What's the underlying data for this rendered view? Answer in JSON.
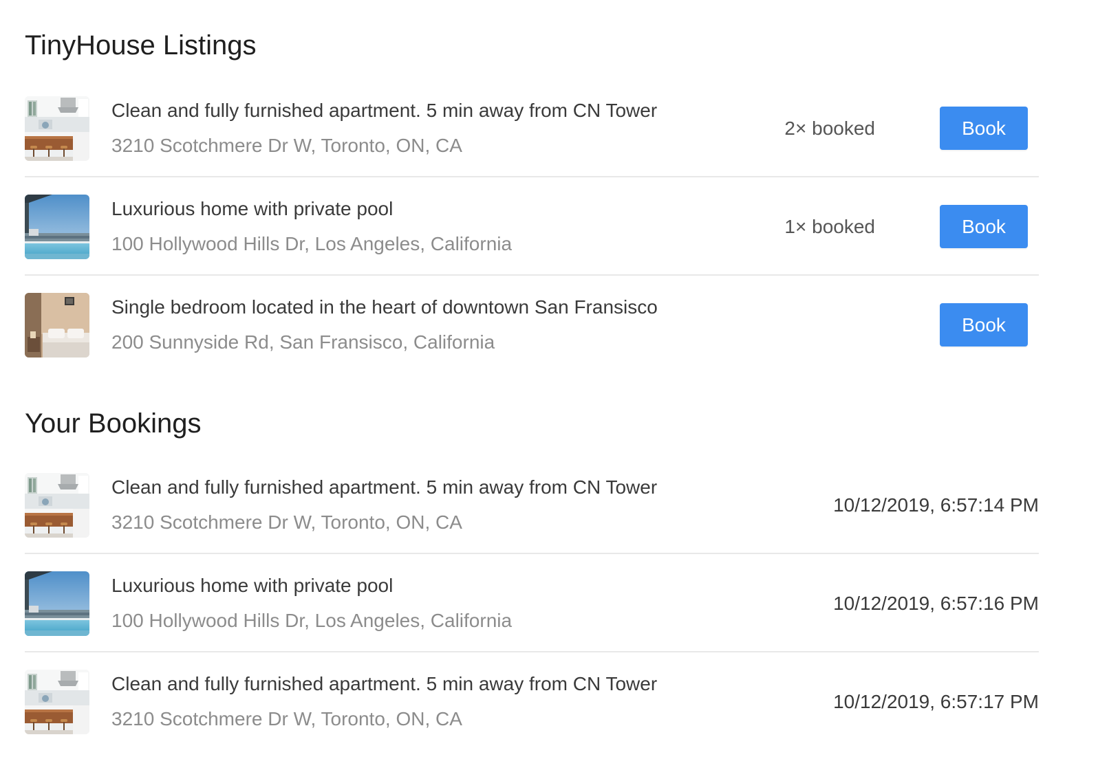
{
  "listings": {
    "title": "TinyHouse Listings",
    "items": [
      {
        "title": "Clean and fully furnished apartment. 5 min away from CN Tower",
        "address": "3210 Scotchmere Dr W, Toronto, ON, CA",
        "booked": "2× booked",
        "book_label": "Book",
        "image": "kitchen-photo"
      },
      {
        "title": "Luxurious home with private pool",
        "address": "100 Hollywood Hills Dr, Los Angeles, California",
        "booked": "1× booked",
        "book_label": "Book",
        "image": "pool-photo"
      },
      {
        "title": "Single bedroom located in the heart of downtown San Fransisco",
        "address": "200 Sunnyside Rd, San Fransisco, California",
        "booked": "",
        "book_label": "Book",
        "image": "bedroom-photo"
      }
    ]
  },
  "bookings": {
    "title": "Your Bookings",
    "items": [
      {
        "title": "Clean and fully furnished apartment. 5 min away from CN Tower",
        "address": "3210 Scotchmere Dr W, Toronto, ON, CA",
        "timestamp": "10/12/2019, 6:57:14 PM",
        "image": "kitchen-photo"
      },
      {
        "title": "Luxurious home with private pool",
        "address": "100 Hollywood Hills Dr, Los Angeles, California",
        "timestamp": "10/12/2019, 6:57:16 PM",
        "image": "pool-photo"
      },
      {
        "title": "Clean and fully furnished apartment. 5 min away from CN Tower",
        "address": "3210 Scotchmere Dr W, Toronto, ON, CA",
        "timestamp": "10/12/2019, 6:57:17 PM",
        "image": "kitchen-photo"
      }
    ]
  },
  "colors": {
    "button": "#3b8cf0",
    "divider": "#e8e8e8",
    "secondary_text": "#8c8c8c"
  }
}
